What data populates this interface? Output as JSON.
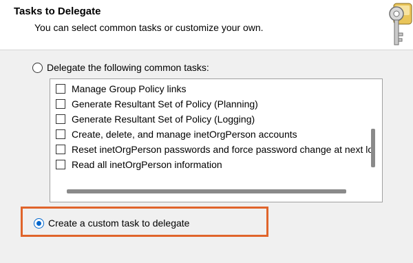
{
  "header": {
    "title": "Tasks to Delegate",
    "subtitle": "You can select common tasks or customize your own.",
    "icon": "keys-icon"
  },
  "options": {
    "common_label": "Delegate the following common tasks:",
    "common_selected": false,
    "custom_label": "Create a custom task to delegate",
    "custom_selected": true
  },
  "tasks": [
    {
      "label": "Manage Group Policy links",
      "checked": false
    },
    {
      "label": "Generate Resultant Set of Policy (Planning)",
      "checked": false
    },
    {
      "label": "Generate Resultant Set of Policy (Logging)",
      "checked": false
    },
    {
      "label": "Create, delete, and manage inetOrgPerson accounts",
      "checked": false
    },
    {
      "label": "Reset inetOrgPerson passwords and force password change at next lo",
      "checked": false
    },
    {
      "label": "Read all inetOrgPerson information",
      "checked": false
    }
  ],
  "colors": {
    "accent": "#0066cc",
    "highlight": "#e0642b",
    "panel": "#f0f0f0"
  }
}
